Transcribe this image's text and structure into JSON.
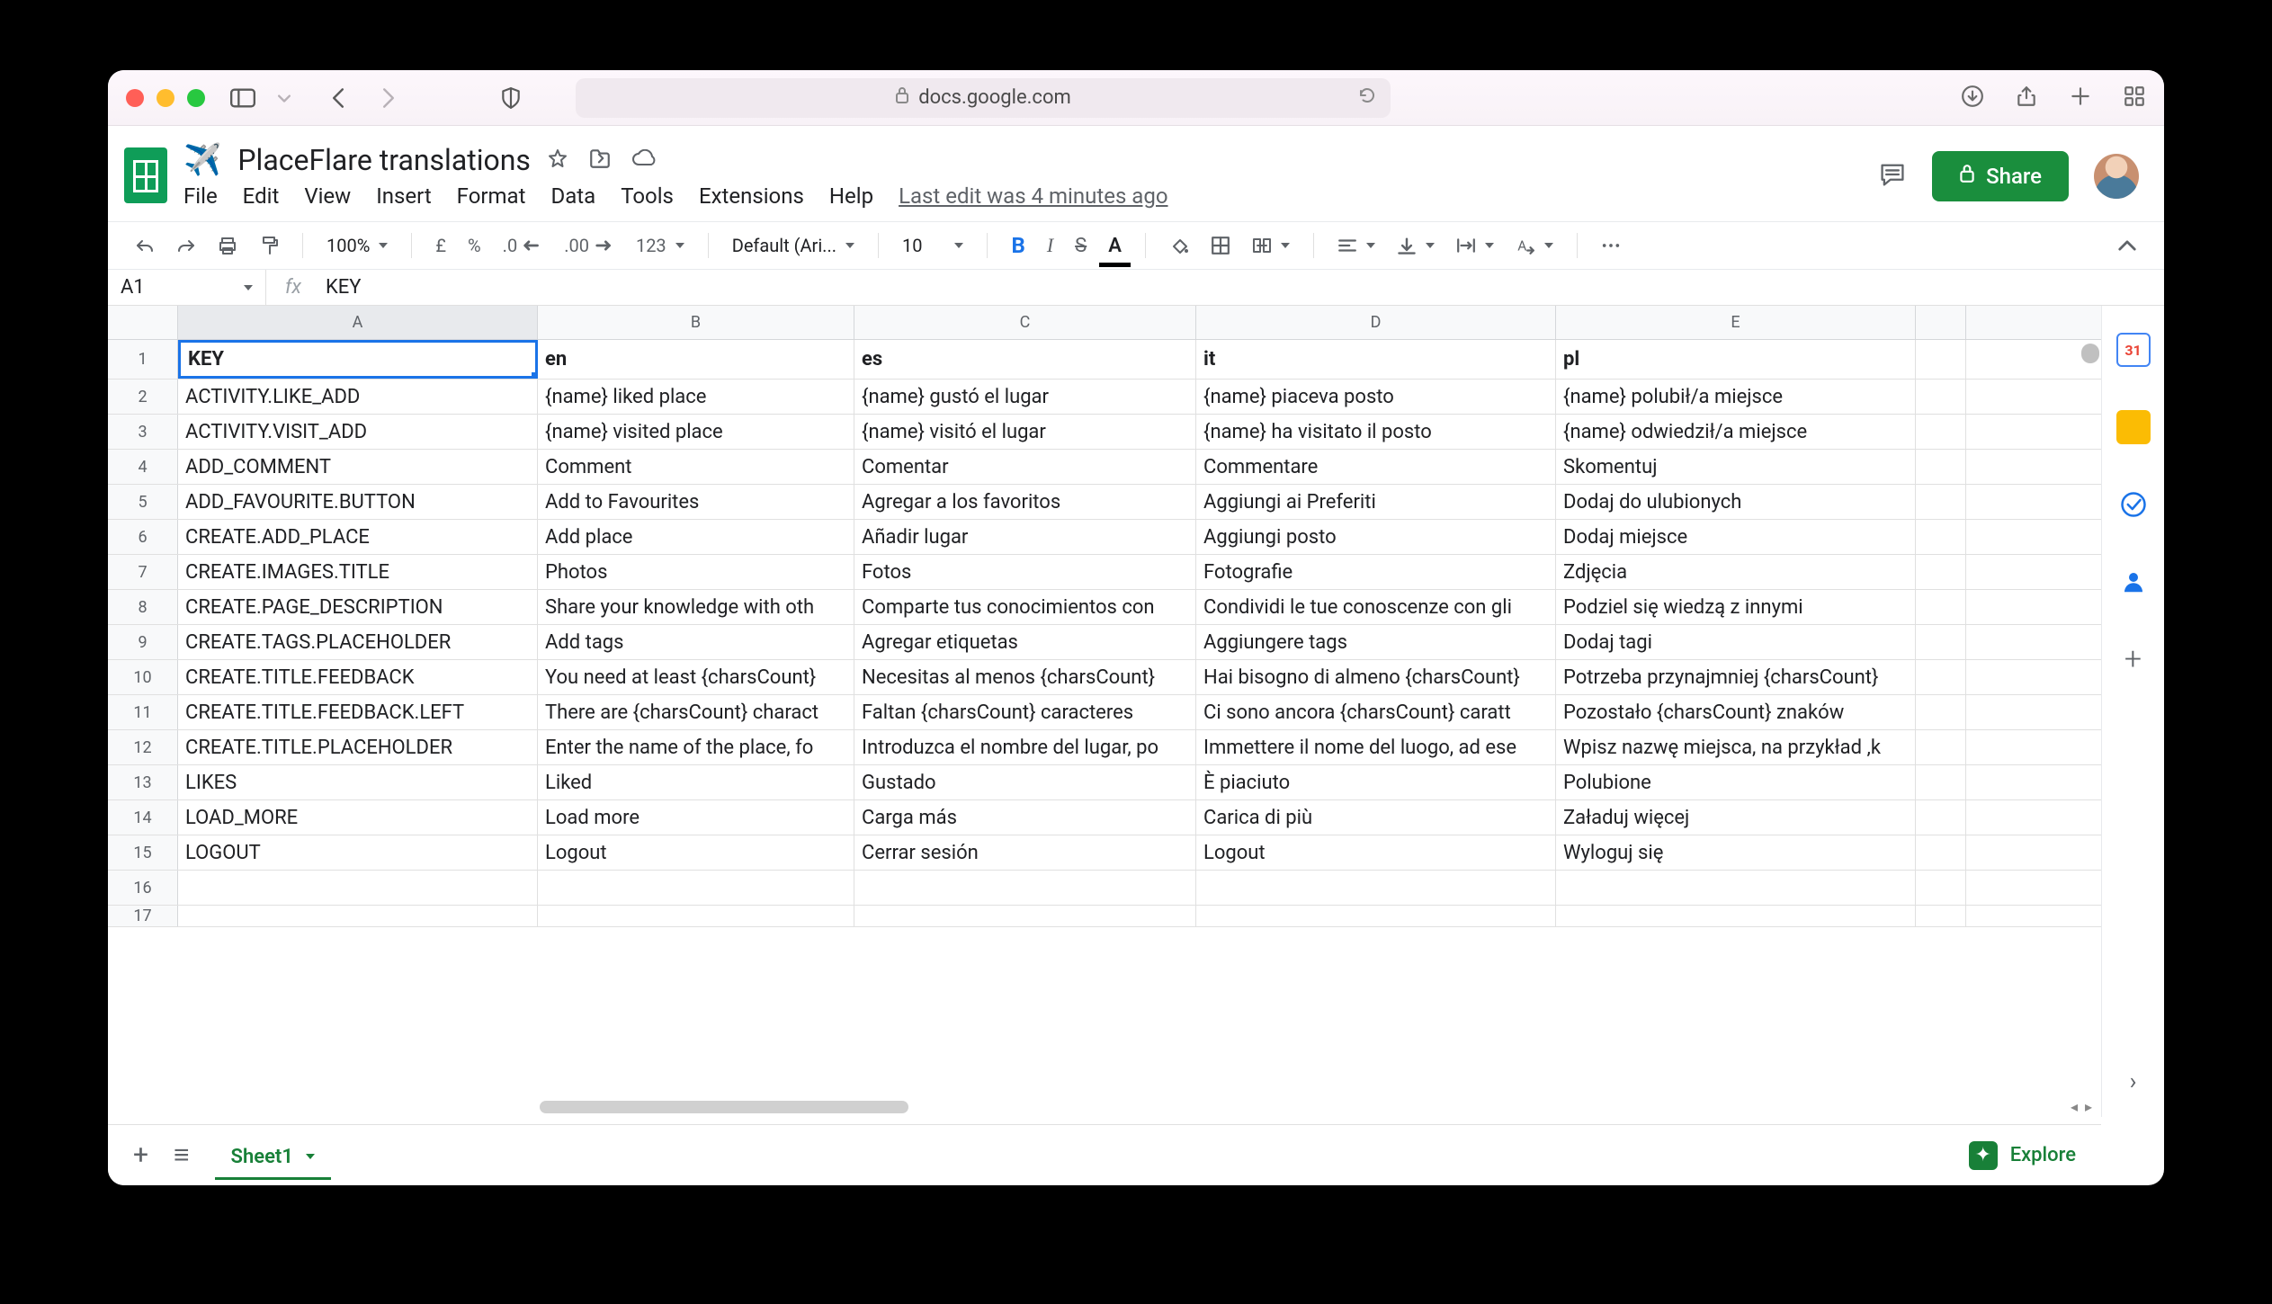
{
  "browser": {
    "address": "docs.google.com"
  },
  "doc": {
    "emoji": "✈️",
    "title": "PlaceFlare translations",
    "last_edit": "Last edit was 4 minutes ago"
  },
  "menus": {
    "file": "File",
    "edit": "Edit",
    "view": "View",
    "insert": "Insert",
    "format": "Format",
    "data": "Data",
    "tools": "Tools",
    "extensions": "Extensions",
    "help": "Help"
  },
  "share": {
    "label": "Share"
  },
  "toolbar": {
    "zoom": "100%",
    "currency": "£",
    "percent": "%",
    "dec_dec": ".0",
    "dec_inc": ".00",
    "numfmt": "123",
    "font": "Default (Ari...",
    "size": "10",
    "bold": "B",
    "italic": "I",
    "strike": "S",
    "color": "A"
  },
  "namebox": "A1",
  "fx_value": "KEY",
  "columns": {
    "A": "A",
    "B": "B",
    "C": "C",
    "D": "D",
    "E": "E",
    "F": ""
  },
  "chart_data": {
    "type": "table",
    "columns": [
      "KEY",
      "en",
      "es",
      "it",
      "pl"
    ],
    "rows": [
      [
        "ACTIVITY.LIKE_ADD",
        "{name} liked place",
        "{name} gustó el lugar",
        "{name} piaceva posto",
        "{name} polubił/a miejsce"
      ],
      [
        "ACTIVITY.VISIT_ADD",
        "{name} visited place",
        "{name} visitó el lugar",
        "{name} ha visitato il posto",
        "{name} odwiedził/a miejsce"
      ],
      [
        "ADD_COMMENT",
        "Comment",
        "Comentar",
        "Commentare",
        "Skomentuj"
      ],
      [
        "ADD_FAVOURITE.BUTTON",
        "Add to Favourites",
        "Agregar a los favoritos",
        "Aggiungi ai Preferiti",
        "Dodaj do ulubionych"
      ],
      [
        "CREATE.ADD_PLACE",
        "Add place",
        "Añadir lugar",
        "Aggiungi posto",
        "Dodaj miejsce"
      ],
      [
        "CREATE.IMAGES.TITLE",
        "Photos",
        "Fotos",
        "Fotografie",
        "Zdjęcia"
      ],
      [
        "CREATE.PAGE_DESCRIPTION",
        "Share your knowledge with oth",
        "Comparte tus conocimientos con",
        "Condividi le tue conoscenze con gli",
        "Podziel się wiedzą z innymi"
      ],
      [
        "CREATE.TAGS.PLACEHOLDER",
        "Add tags",
        "Agregar etiquetas",
        "Aggiungere tags",
        "Dodaj tagi"
      ],
      [
        "CREATE.TITLE.FEEDBACK",
        "You need at least {charsCount}",
        "Necesitas al menos {charsCount}",
        "Hai bisogno di almeno {charsCount}",
        "Potrzeba przynajmniej {charsCount}"
      ],
      [
        "CREATE.TITLE.FEEDBACK.LEFT",
        "There are {charsCount} charact",
        "Faltan {charsCount} caracteres",
        "Ci sono ancora {charsCount} caratt",
        "Pozostało {charsCount} znaków"
      ],
      [
        "CREATE.TITLE.PLACEHOLDER",
        "Enter the name of the place, fo",
        "Introduzca el nombre del lugar, po",
        "Immettere il nome del luogo, ad ese",
        "Wpisz nazwę miejsca, na przykład ‚k"
      ],
      [
        "LIKES",
        "Liked",
        "Gustado",
        "È piaciuto",
        "Polubione"
      ],
      [
        "LOAD_MORE",
        "Load more",
        "Carga más",
        "Carica di più",
        "Załaduj więcej"
      ],
      [
        "LOGOUT",
        "Logout",
        "Cerrar sesión",
        "Logout",
        "Wyloguj się"
      ]
    ]
  },
  "tabs": {
    "sheet1": "Sheet1"
  },
  "explore": {
    "label": "Explore"
  },
  "sidepanel": {
    "cal": "31"
  }
}
